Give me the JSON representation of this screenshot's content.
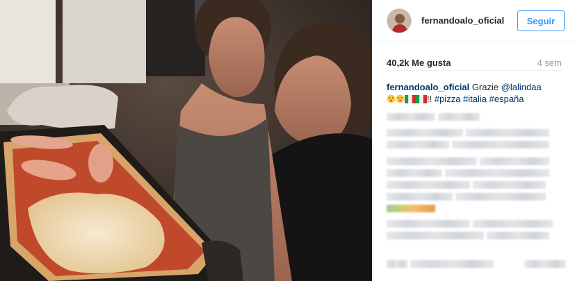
{
  "post": {
    "username": "fernandoalo_oficial",
    "follow_label": "Seguir",
    "likes": "40,2k Me gusta",
    "time_ago": "4 sem",
    "caption": {
      "author": "fernandoalo_oficial",
      "text_start": " Grazie ",
      "mention": "@lalindaa",
      "text_mid": "!! ",
      "hashtags": [
        "#pizza",
        "#italia",
        "#españa"
      ],
      "emojis": [
        "kissing-heart-emoji",
        "kissing-heart-emoji",
        "flag-italy-emoji",
        "flag-italy-emoji"
      ]
    },
    "photo_description_icon": "photo"
  },
  "colors": {
    "link": "#003569",
    "follow_blue": "#3897f0",
    "muted": "#999999"
  }
}
